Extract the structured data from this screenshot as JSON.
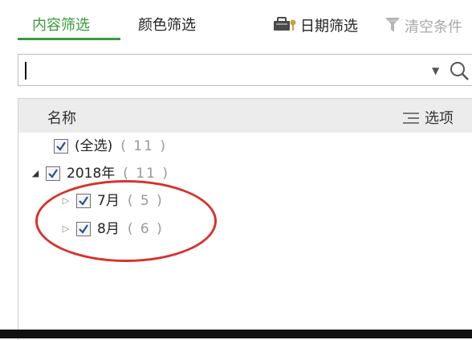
{
  "tabs": {
    "content_filter": "内容筛选",
    "color_filter": "颜色筛选",
    "date_filter": "日期筛选",
    "clear_conditions": "清空条件"
  },
  "search": {
    "value": "",
    "placeholder": ""
  },
  "list": {
    "header_name": "名称",
    "header_options": "选项",
    "rows": [
      {
        "label": "(全选)",
        "count": "( 11 )",
        "checked": true,
        "level": 0
      },
      {
        "label": "2018年",
        "count": "( 11 )",
        "checked": true,
        "level": 0,
        "expanded": true
      },
      {
        "label": "7月",
        "count": "( 5 )",
        "checked": true,
        "level": 1,
        "expanded": false
      },
      {
        "label": "8月",
        "count": "( 6 )",
        "checked": true,
        "level": 1,
        "expanded": false
      }
    ]
  },
  "colors": {
    "accent": "#3a9a3a",
    "highlight": "#d8322d",
    "header_bg": "#ececec"
  },
  "icons": [
    "lock-icon",
    "clear-filter-icon",
    "dropdown-arrow-icon",
    "search-icon",
    "options-icon",
    "checkbox-check-icon",
    "expand-arrow-icon"
  ]
}
